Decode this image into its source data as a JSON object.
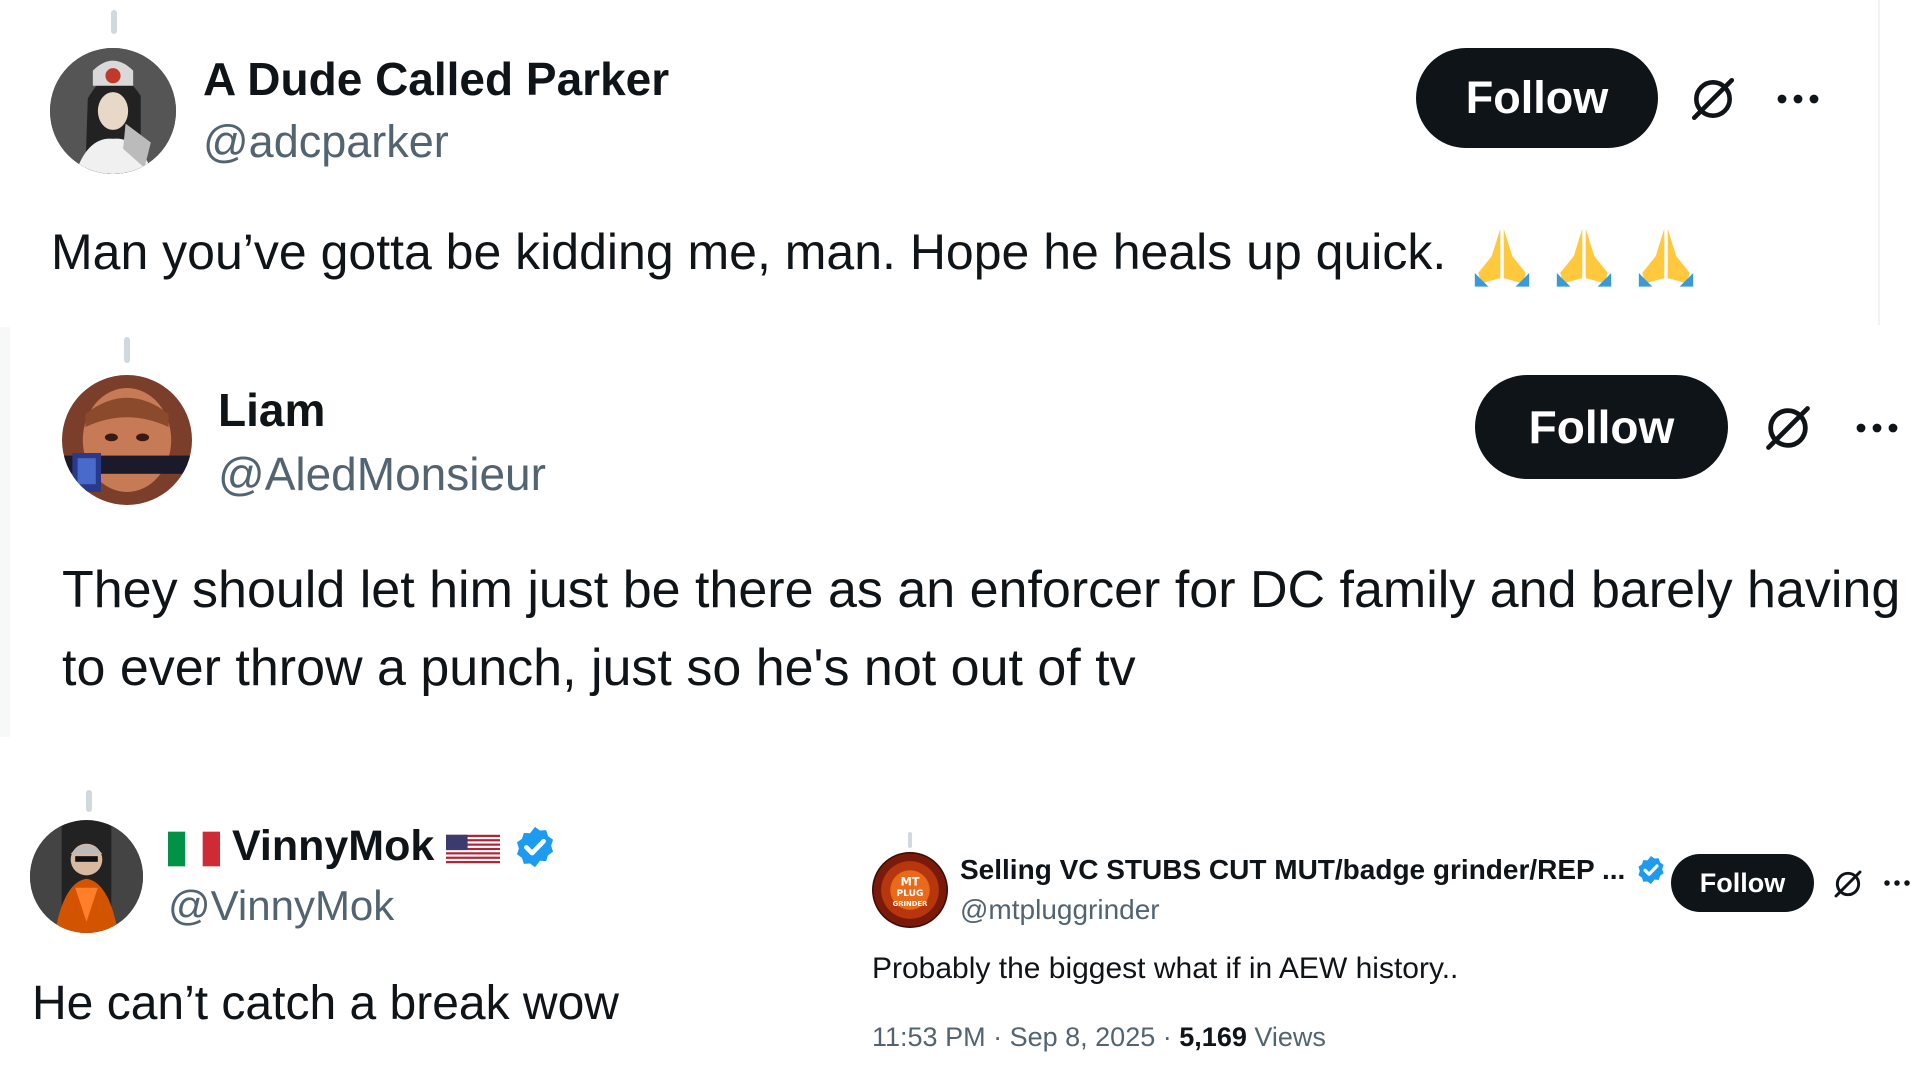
{
  "colors": {
    "text_primary": "#0f1419",
    "text_secondary": "#536471",
    "follow_bg": "#0f1419",
    "follow_text": "#ffffff",
    "verified_blue": "#1d9bf0",
    "divider": "#eff3f4"
  },
  "tweets": [
    {
      "name": "A Dude Called Parker",
      "handle": "@adcparker",
      "text": "Man you’ve gotta be kidding me, man. Hope he heals up quick.",
      "emojis": [
        "folded-hands",
        "folded-hands",
        "folded-hands"
      ],
      "follow_label": "Follow",
      "icons": [
        "grok-icon",
        "more-icon"
      ]
    },
    {
      "name": "Liam",
      "handle": "@AledMonsieur",
      "text": "They should let him just be there as an enforcer for DC family and barely having to ever throw a punch, just so he's not out of tv",
      "follow_label": "Follow",
      "icons": [
        "grok-icon",
        "more-icon"
      ]
    },
    {
      "name": "VinnyMok",
      "handle": "@VinnyMok",
      "name_prefix_icon": "italy-flag-icon",
      "name_suffix_icons": [
        "us-flag-icon",
        "verified-badge-icon"
      ],
      "text": "He can’t catch a break wow"
    },
    {
      "name": "Selling VC STUBS CUT MUT/badge grinder/REP ...",
      "handle": "@mtpluggrinder",
      "avatar_text": "MT PLUG GRINDER",
      "verified": true,
      "follow_label": "Follow",
      "text": "Probably the biggest what if in AEW history..",
      "time": "11:53 PM",
      "date": "Sep 8, 2025",
      "views_count": "5,169",
      "views_label": "Views",
      "separator": "·",
      "icons": [
        "grok-icon",
        "more-icon"
      ]
    }
  ]
}
